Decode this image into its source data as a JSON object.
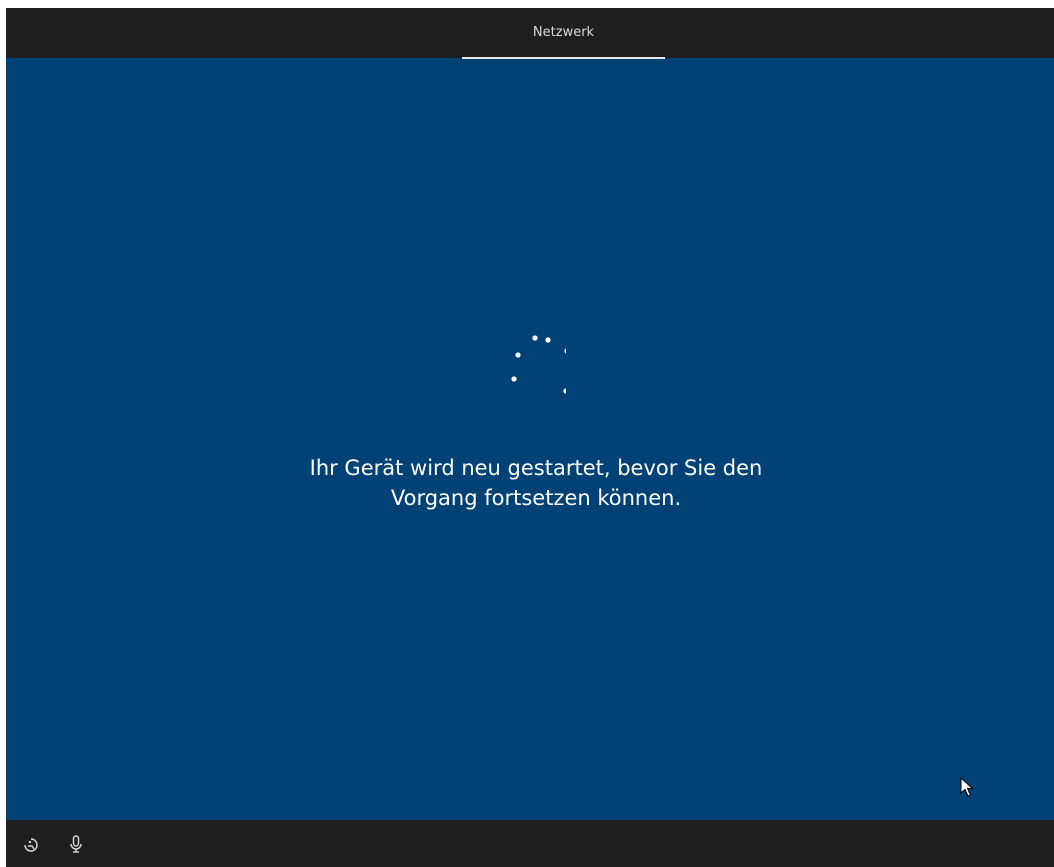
{
  "header": {
    "active_tab": "Netzwerk"
  },
  "main": {
    "spinner_icon": "loading-dots-icon",
    "message_line1": "Ihr Gerät wird neu gestartet, bevor Sie den",
    "message_line2": "Vorgang fortsetzen können."
  },
  "footer": {
    "icons": [
      "ease-of-access-icon",
      "microphone-icon"
    ]
  },
  "colors": {
    "background": "#004275",
    "bars": "#1f1f1f",
    "text": "#ffffff"
  }
}
